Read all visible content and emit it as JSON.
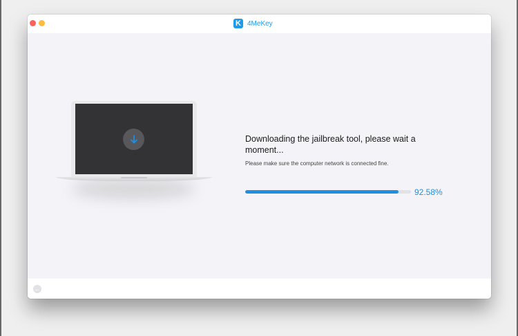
{
  "window": {
    "title": "4MeKey",
    "logo_letter": "K",
    "accent_color": "#1e9be9"
  },
  "main": {
    "illustration": {
      "screen_icon": "download-arrow-icon"
    },
    "status_title": "Downloading the jailbreak tool, please wait a moment...",
    "status_subtitle": "Please make sure the computer network is connected fine.",
    "progress": {
      "value": 0.9258,
      "label": "92.58%"
    }
  },
  "footer": {
    "back_icon": "back-arrow-icon"
  }
}
